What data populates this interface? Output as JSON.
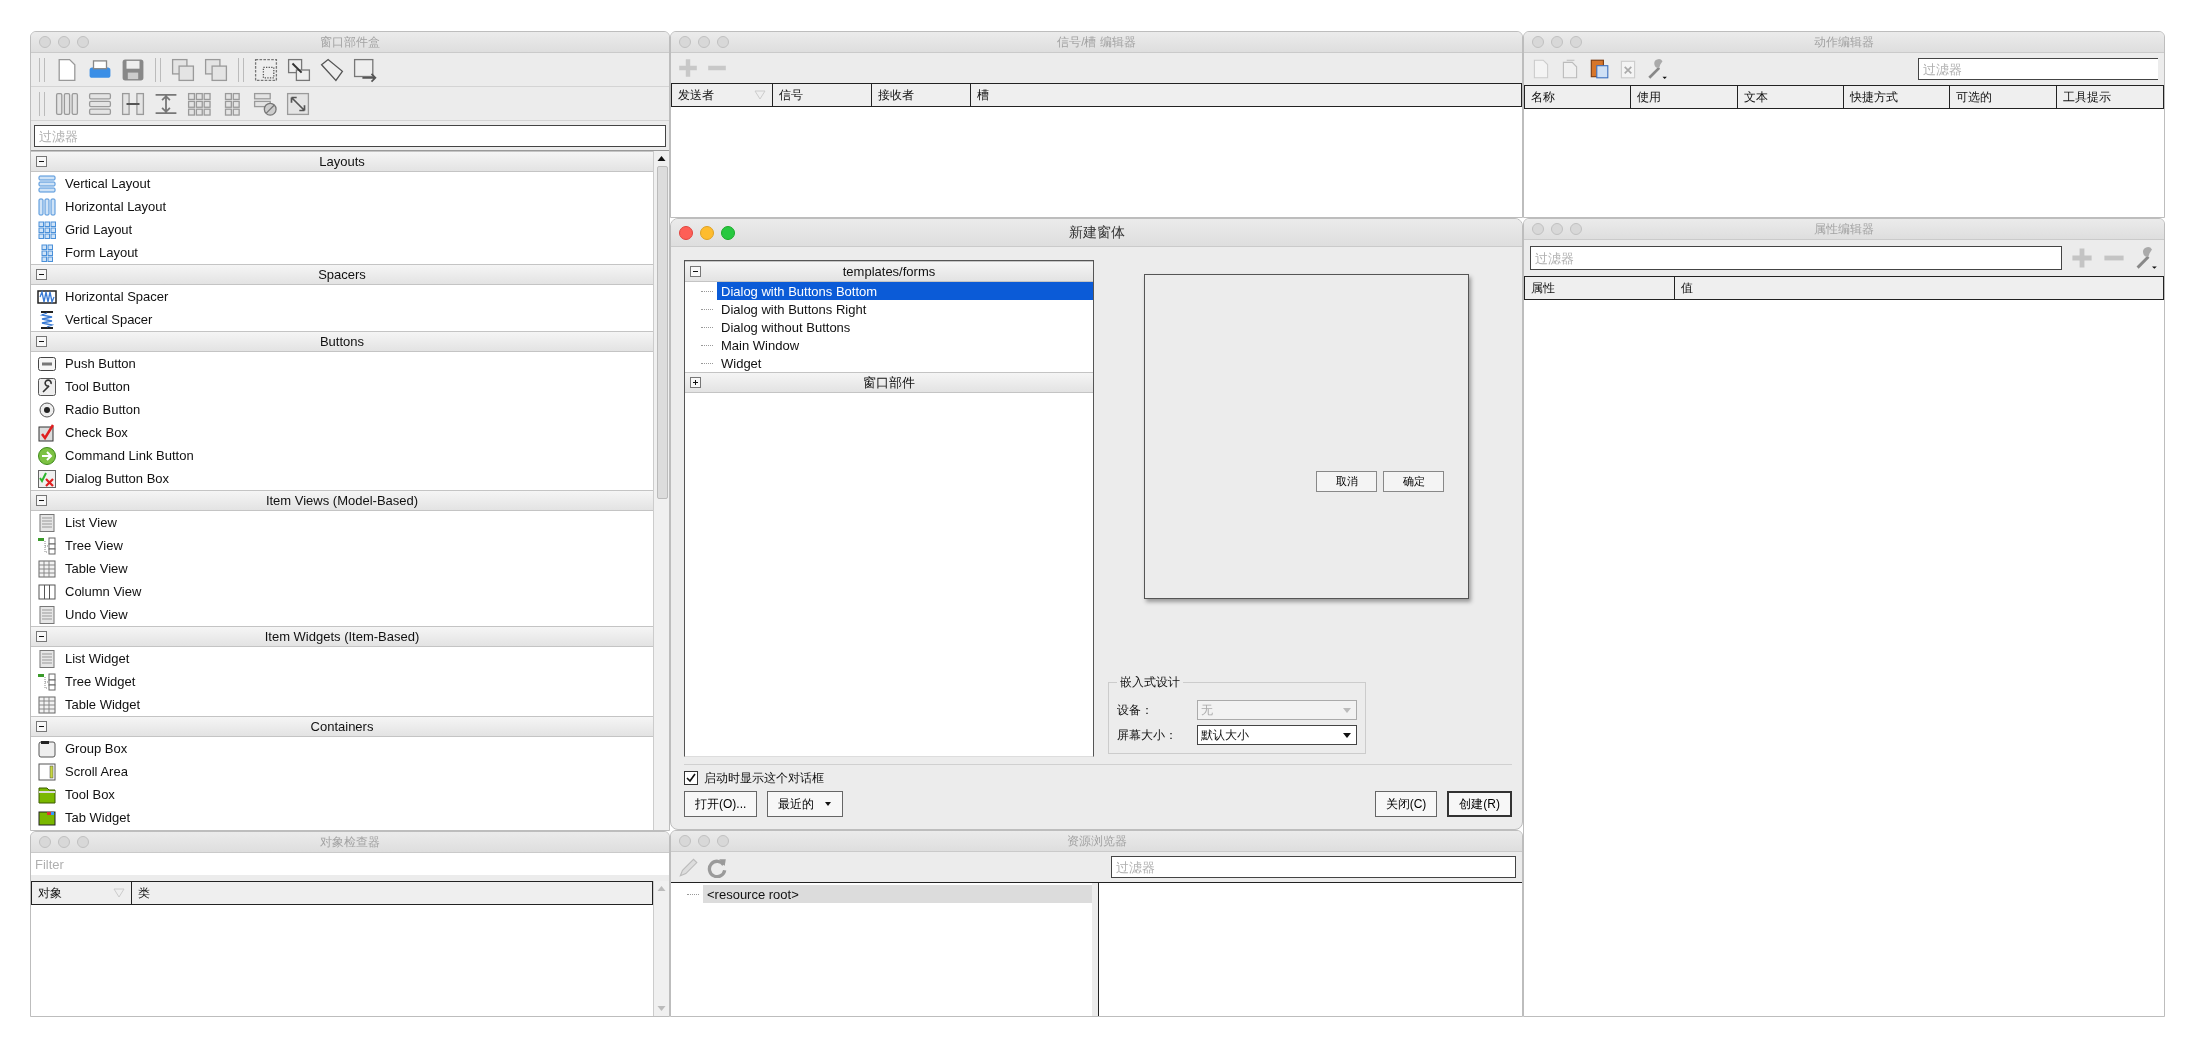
{
  "widget_box": {
    "title": "窗口部件盒",
    "active": false,
    "filter": {
      "placeholder": "过滤器"
    },
    "categories": [
      {
        "name": "Layouts",
        "expanded": true,
        "items": [
          "Vertical Layout",
          "Horizontal Layout",
          "Grid Layout",
          "Form Layout"
        ]
      },
      {
        "name": "Spacers",
        "expanded": true,
        "items": [
          "Horizontal Spacer",
          "Vertical Spacer"
        ]
      },
      {
        "name": "Buttons",
        "expanded": true,
        "items": [
          "Push Button",
          "Tool Button",
          "Radio Button",
          "Check Box",
          "Command Link Button",
          "Dialog Button Box"
        ]
      },
      {
        "name": "Item Views (Model-Based)",
        "expanded": true,
        "items": [
          "List View",
          "Tree View",
          "Table View",
          "Column View",
          "Undo View"
        ]
      },
      {
        "name": "Item Widgets (Item-Based)",
        "expanded": true,
        "items": [
          "List Widget",
          "Tree Widget",
          "Table Widget"
        ]
      },
      {
        "name": "Containers",
        "expanded": true,
        "items": [
          "Group Box",
          "Scroll Area",
          "Tool Box",
          "Tab Widget"
        ]
      }
    ]
  },
  "object_inspector": {
    "title": "对象检查器",
    "active": false,
    "filter": {
      "placeholder": "Filter"
    },
    "columns": [
      {
        "label": "对象",
        "sorted": true
      },
      {
        "label": "类",
        "sorted": false
      }
    ]
  },
  "signal_slot_editor": {
    "title": "信号/槽 编辑器",
    "active": false,
    "columns": [
      {
        "label": "发送者",
        "sorted": true
      },
      {
        "label": "信号",
        "sorted": false
      },
      {
        "label": "接收者",
        "sorted": false
      },
      {
        "label": "槽",
        "sorted": false
      }
    ]
  },
  "new_form_dialog": {
    "title": "新建窗体",
    "active": true,
    "template_tree": [
      {
        "name": "templates/forms",
        "expanded": true,
        "children": [
          {
            "label": "Dialog with Buttons Bottom",
            "selected": true
          },
          {
            "label": "Dialog with Buttons Right",
            "selected": false
          },
          {
            "label": "Dialog without Buttons",
            "selected": false
          },
          {
            "label": "Main Window",
            "selected": false
          },
          {
            "label": "Widget",
            "selected": false
          }
        ]
      },
      {
        "name": "窗口部件",
        "expanded": false
      }
    ],
    "preview": {
      "buttons": [
        "取消",
        "确定"
      ]
    },
    "embedded_design": {
      "title": "嵌入式设计",
      "fields": [
        {
          "label": "设备：",
          "value": "无",
          "disabled": true
        },
        {
          "label": "屏幕大小：",
          "value": "默认大小",
          "disabled": false
        }
      ]
    },
    "show_on_startup": {
      "label": "启动时显示这个对话框",
      "checked": true
    },
    "left_buttons": [
      {
        "label": "打开(O)...",
        "kind": "plain"
      },
      {
        "label": "最近的",
        "kind": "menu"
      }
    ],
    "right_buttons": [
      {
        "label": "关闭(C)",
        "kind": "plain"
      },
      {
        "label": "创建(R)",
        "kind": "default"
      }
    ]
  },
  "resource_browser": {
    "title": "资源浏览器",
    "active": false,
    "filter": {
      "placeholder": "过滤器"
    },
    "tree": [
      {
        "label": "<resource root>",
        "selected": true
      }
    ]
  },
  "action_editor": {
    "title": "动作编辑器",
    "active": false,
    "filter": {
      "placeholder": "过滤器"
    },
    "columns": [
      {
        "label": "名称",
        "sorted": false
      },
      {
        "label": "使用",
        "sorted": false
      },
      {
        "label": "文本",
        "sorted": false
      },
      {
        "label": "快捷方式",
        "sorted": false
      },
      {
        "label": "可选的",
        "sorted": false
      },
      {
        "label": "工具提示",
        "sorted": false
      }
    ]
  },
  "property_editor": {
    "title": "属性编辑器",
    "active": false,
    "filter": {
      "placeholder": "过滤器"
    },
    "columns": [
      {
        "label": "属性",
        "sorted": false
      },
      {
        "label": "值",
        "sorted": false
      }
    ]
  }
}
